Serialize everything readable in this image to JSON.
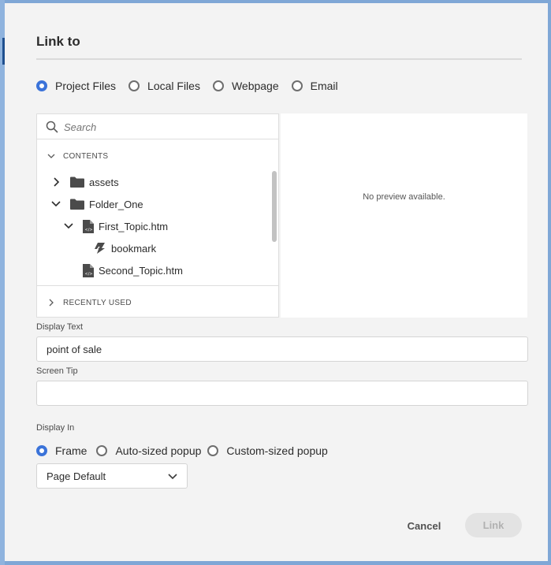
{
  "dialog": {
    "title": "Link to"
  },
  "link_type": {
    "options": [
      "Project Files",
      "Local Files",
      "Webpage",
      "Email"
    ],
    "selected": "Project Files"
  },
  "browser": {
    "search_placeholder": "Search",
    "contents_label": "CONTENTS",
    "recent_label": "RECENTLY USED",
    "tree": [
      {
        "label": "assets",
        "type": "folder",
        "state": "collapsed"
      },
      {
        "label": "Folder_One",
        "type": "folder",
        "state": "expanded"
      },
      {
        "label": "First_Topic.htm",
        "type": "topic",
        "state": "expanded"
      },
      {
        "label": "bookmark",
        "type": "bookmark"
      },
      {
        "label": "Second_Topic.htm",
        "type": "topic"
      }
    ]
  },
  "preview": {
    "text": "No preview available."
  },
  "display_text": {
    "label": "Display Text",
    "value": "point of sale"
  },
  "screen_tip": {
    "label": "Screen Tip",
    "value": ""
  },
  "display_in": {
    "label": "Display In",
    "options": [
      "Frame",
      "Auto-sized popup",
      "Custom-sized popup"
    ],
    "selected": "Frame",
    "dropdown_value": "Page Default"
  },
  "actions": {
    "cancel": "Cancel",
    "link": "Link"
  },
  "colors": {
    "accent": "#3b73d9",
    "background": "#f3f3f3"
  },
  "icons": [
    "search-icon",
    "chevron-down-icon",
    "chevron-right-icon",
    "folder-icon",
    "topic-file-icon",
    "bookmark-icon"
  ]
}
